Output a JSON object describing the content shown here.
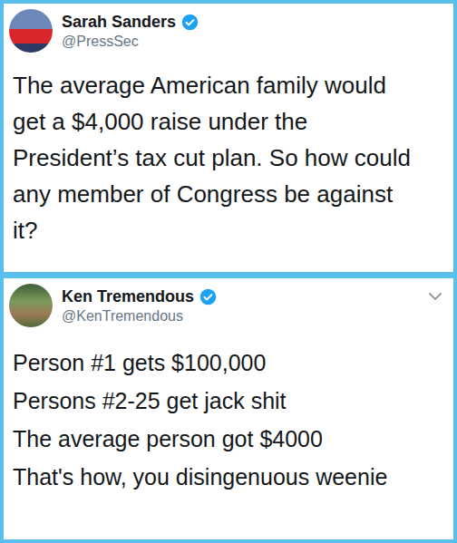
{
  "tweets": [
    {
      "name": "Sarah Sanders",
      "handle": "@PressSec",
      "verified": true,
      "menu": false,
      "lines": [
        "The average American family would",
        "get a $4,000 raise under the",
        "President’s tax cut plan. So how could",
        "any member of Congress be against",
        "it?"
      ]
    },
    {
      "name": "Ken Tremendous",
      "handle": "@KenTremendous",
      "verified": true,
      "menu": true,
      "lines": [
        "Person #1 gets $100,000",
        "Persons #2-25 get jack shit",
        "The average person got $4000",
        "That's how, you disingenuous weenie"
      ]
    }
  ]
}
